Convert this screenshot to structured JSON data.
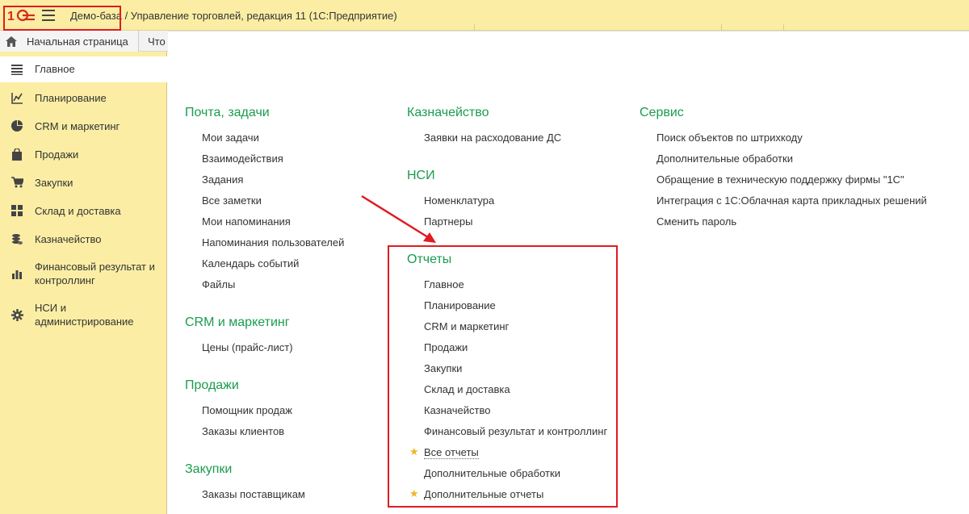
{
  "window": {
    "app_title": "Демо-база / Управление торговлей, редакция 11  (1С:Предприятие)",
    "logo_text": "1С"
  },
  "tabs": {
    "home": "Начальная страница",
    "next": "Что"
  },
  "sidebar": {
    "items": [
      {
        "label": "Главное",
        "icon": "list-icon"
      },
      {
        "label": "Планирование",
        "icon": "planning-icon"
      },
      {
        "label": "CRM и маркетинг",
        "icon": "pie-chart-icon"
      },
      {
        "label": "Продажи",
        "icon": "shopping-bag-icon"
      },
      {
        "label": "Закупки",
        "icon": "cart-icon"
      },
      {
        "label": "Склад и доставка",
        "icon": "grid-icon"
      },
      {
        "label": "Казначейство",
        "icon": "coins-icon"
      },
      {
        "label": "Финансовый результат и контроллинг",
        "icon": "bar-chart-icon"
      },
      {
        "label": "НСИ и администрирование",
        "icon": "gear-icon"
      }
    ]
  },
  "content": {
    "col1": {
      "mail": {
        "title": "Почта, задачи",
        "links": [
          "Мои задачи",
          "Взаимодействия",
          "Задания",
          "Все заметки",
          "Мои напоминания",
          "Напоминания пользователей",
          "Календарь событий",
          "Файлы"
        ]
      },
      "crm": {
        "title": "CRM и маркетинг",
        "links": [
          "Цены (прайс-лист)"
        ]
      },
      "sales": {
        "title": "Продажи",
        "links": [
          "Помощник продаж",
          "Заказы клиентов"
        ]
      },
      "purchases": {
        "title": "Закупки",
        "links": [
          "Заказы поставщикам"
        ]
      }
    },
    "col2": {
      "treasury": {
        "title": "Казначейство",
        "links": [
          "Заявки на расходование ДС"
        ]
      },
      "nsi": {
        "title": "НСИ",
        "links": [
          "Номенклатура",
          "Партнеры"
        ]
      },
      "reports": {
        "title": "Отчеты",
        "links": [
          "Главное",
          "Планирование",
          "CRM и маркетинг",
          "Продажи",
          "Закупки",
          "Склад и доставка",
          "Казначейство",
          "Финансовый результат и контроллинг",
          "Все отчеты",
          "Дополнительные обработки",
          "Дополнительные отчеты"
        ]
      }
    },
    "col3": {
      "service": {
        "title": "Сервис",
        "links": [
          "Поиск объектов по штрихкоду",
          "Дополнительные обработки",
          "Обращение в техническую поддержку фирмы \"1С\"",
          "Интеграция с 1С:Облачная карта прикладных решений",
          "Сменить пароль"
        ]
      }
    }
  },
  "colors": {
    "accent_green": "#1a9c4f",
    "highlight_red": "#e01b22",
    "panel_yellow": "#fbeea4",
    "star": "#f0b429"
  }
}
